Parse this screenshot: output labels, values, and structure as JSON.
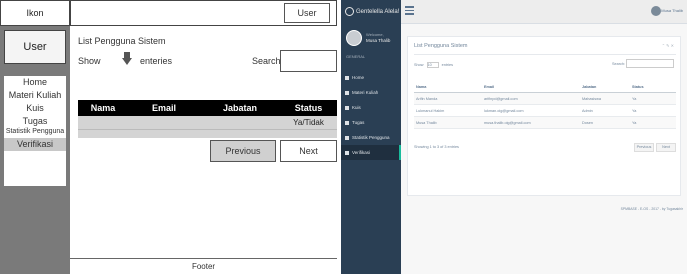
{
  "wireframe": {
    "icon_label": "Ikon",
    "user_box": "User",
    "top_user_button": "User",
    "menu": [
      "Home",
      "Materi Kuliah",
      "Kuis",
      "Tugas"
    ],
    "menu_small": "Statistik Pengguna",
    "menu_active": "Verifikasi",
    "title": "List Pengguna Sistem",
    "show_label": "Show",
    "entries_label": "enteries",
    "search_label": "Search",
    "table": {
      "headers": [
        "Nama",
        "Email",
        "Jabatan",
        "Status"
      ],
      "row": [
        "",
        "",
        "",
        "Ya/Tidak"
      ]
    },
    "previous_button": "Previous",
    "next_button": "Next",
    "footer": "Footer"
  },
  "screenshot": {
    "brand": "Gentelella Alela!",
    "welcome": "Welcome,",
    "username": "Musa Thalib",
    "section": "GENERAL",
    "menu": [
      "Home",
      "Materi Kuliah",
      "Kuis",
      "Tugas",
      "Statistik Pengguna",
      "Verifikasi"
    ],
    "top_user": "Musa Thalib",
    "panel_title": "List Pengguna Sistem",
    "panel_tools": "⌃ ✎ ✕",
    "show_label": "Show",
    "select_value": "10",
    "entries_label": "entries",
    "search_label": "Search:",
    "table": {
      "headers": [
        "Nama",
        "Email",
        "Jabatan",
        "Status"
      ],
      "rows": [
        [
          "Arifin Manda",
          "arifinpd@gmail.com",
          "Mahasiswa",
          "Ya"
        ],
        [
          "Lukmanul Hakim",
          "lukman.oig@gmail.com",
          "Admin",
          "Ya"
        ],
        [
          "Musa Thalib",
          "musa.thalib.oig@gmail.com",
          "Dosen",
          "Ya"
        ]
      ]
    },
    "info": "Showing 1 to 3 of 3 entries",
    "previous": "Previous",
    "next": "Next",
    "footer": "SPMBASE - E-OS - 2017 - by Tugasakhir",
    "colors": {
      "sidebar": "#2a3f54",
      "accent": "#1abb9c",
      "text": "#73879c"
    }
  }
}
